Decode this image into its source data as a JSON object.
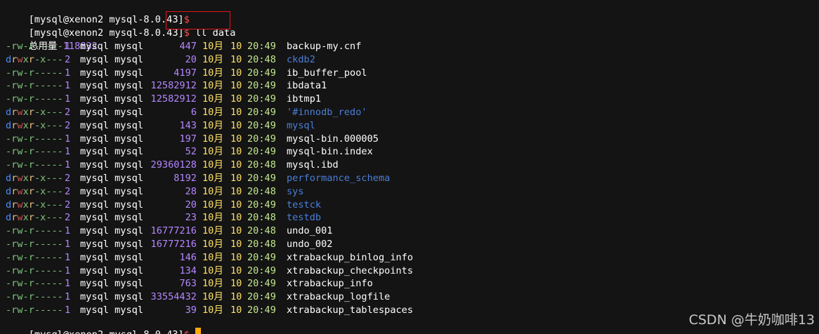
{
  "terminal": {
    "prompt_text": "[mysql@xenon2 mysql-8.0.43]",
    "prompt_symbol": "$",
    "command": "ll data",
    "total_label": "总用量",
    "total_value": "118832",
    "rows": [
      {
        "perm": "-rw-r-----",
        "links": "1",
        "owner": "mysql mysql",
        "size": "447",
        "month": "10月",
        "day": "10",
        "time": "20:49",
        "name": "backup-my.cnf",
        "is_dir": false
      },
      {
        "perm": "drwxr-x---",
        "links": "2",
        "owner": "mysql mysql",
        "size": "20",
        "month": "10月",
        "day": "10",
        "time": "20:48",
        "name": "ckdb2",
        "is_dir": true
      },
      {
        "perm": "-rw-r-----",
        "links": "1",
        "owner": "mysql mysql",
        "size": "4197",
        "month": "10月",
        "day": "10",
        "time": "20:49",
        "name": "ib_buffer_pool",
        "is_dir": false
      },
      {
        "perm": "-rw-r-----",
        "links": "1",
        "owner": "mysql mysql",
        "size": "12582912",
        "month": "10月",
        "day": "10",
        "time": "20:49",
        "name": "ibdata1",
        "is_dir": false
      },
      {
        "perm": "-rw-r-----",
        "links": "1",
        "owner": "mysql mysql",
        "size": "12582912",
        "month": "10月",
        "day": "10",
        "time": "20:49",
        "name": "ibtmp1",
        "is_dir": false
      },
      {
        "perm": "drwxr-x---",
        "links": "2",
        "owner": "mysql mysql",
        "size": "6",
        "month": "10月",
        "day": "10",
        "time": "20:49",
        "name": "'#innodb_redo'",
        "is_dir": true
      },
      {
        "perm": "drwxr-x---",
        "links": "2",
        "owner": "mysql mysql",
        "size": "143",
        "month": "10月",
        "day": "10",
        "time": "20:49",
        "name": "mysql",
        "is_dir": true
      },
      {
        "perm": "-rw-r-----",
        "links": "1",
        "owner": "mysql mysql",
        "size": "197",
        "month": "10月",
        "day": "10",
        "time": "20:49",
        "name": "mysql-bin.000005",
        "is_dir": false
      },
      {
        "perm": "-rw-r-----",
        "links": "1",
        "owner": "mysql mysql",
        "size": "52",
        "month": "10月",
        "day": "10",
        "time": "20:49",
        "name": "mysql-bin.index",
        "is_dir": false
      },
      {
        "perm": "-rw-r-----",
        "links": "1",
        "owner": "mysql mysql",
        "size": "29360128",
        "month": "10月",
        "day": "10",
        "time": "20:48",
        "name": "mysql.ibd",
        "is_dir": false
      },
      {
        "perm": "drwxr-x---",
        "links": "2",
        "owner": "mysql mysql",
        "size": "8192",
        "month": "10月",
        "day": "10",
        "time": "20:49",
        "name": "performance_schema",
        "is_dir": true
      },
      {
        "perm": "drwxr-x---",
        "links": "2",
        "owner": "mysql mysql",
        "size": "28",
        "month": "10月",
        "day": "10",
        "time": "20:48",
        "name": "sys",
        "is_dir": true
      },
      {
        "perm": "drwxr-x---",
        "links": "2",
        "owner": "mysql mysql",
        "size": "20",
        "month": "10月",
        "day": "10",
        "time": "20:49",
        "name": "testck",
        "is_dir": true
      },
      {
        "perm": "drwxr-x---",
        "links": "2",
        "owner": "mysql mysql",
        "size": "23",
        "month": "10月",
        "day": "10",
        "time": "20:48",
        "name": "testdb",
        "is_dir": true
      },
      {
        "perm": "-rw-r-----",
        "links": "1",
        "owner": "mysql mysql",
        "size": "16777216",
        "month": "10月",
        "day": "10",
        "time": "20:48",
        "name": "undo_001",
        "is_dir": false
      },
      {
        "perm": "-rw-r-----",
        "links": "1",
        "owner": "mysql mysql",
        "size": "16777216",
        "month": "10月",
        "day": "10",
        "time": "20:48",
        "name": "undo_002",
        "is_dir": false
      },
      {
        "perm": "-rw-r-----",
        "links": "1",
        "owner": "mysql mysql",
        "size": "146",
        "month": "10月",
        "day": "10",
        "time": "20:49",
        "name": "xtrabackup_binlog_info",
        "is_dir": false
      },
      {
        "perm": "-rw-r-----",
        "links": "1",
        "owner": "mysql mysql",
        "size": "134",
        "month": "10月",
        "day": "10",
        "time": "20:49",
        "name": "xtrabackup_checkpoints",
        "is_dir": false
      },
      {
        "perm": "-rw-r-----",
        "links": "1",
        "owner": "mysql mysql",
        "size": "763",
        "month": "10月",
        "day": "10",
        "time": "20:49",
        "name": "xtrabackup_info",
        "is_dir": false
      },
      {
        "perm": "-rw-r-----",
        "links": "1",
        "owner": "mysql mysql",
        "size": "33554432",
        "month": "10月",
        "day": "10",
        "time": "20:49",
        "name": "xtrabackup_logfile",
        "is_dir": false
      },
      {
        "perm": "-rw-r-----",
        "links": "1",
        "owner": "mysql mysql",
        "size": "39",
        "month": "10月",
        "day": "10",
        "time": "20:49",
        "name": "xtrabackup_tablespaces",
        "is_dir": false
      }
    ]
  },
  "watermark": "CSDN @牛奶咖啡13",
  "colors": {
    "background": "#141414",
    "highlight_box": "#e0161b",
    "cursor": "#ffaa00",
    "dir_name": "#4a7fd9",
    "size": "#b487ff"
  }
}
